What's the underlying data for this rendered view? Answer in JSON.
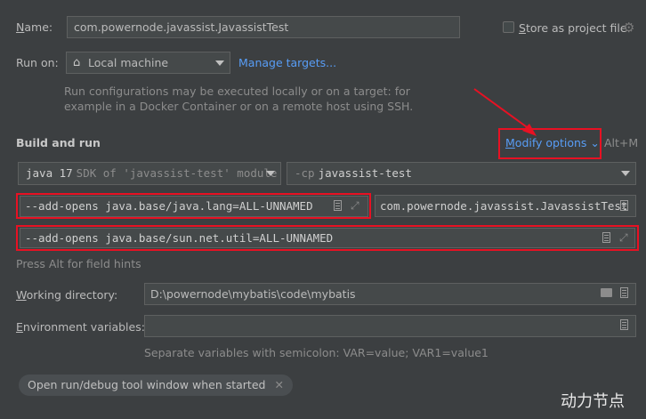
{
  "name": {
    "label": "Name:",
    "value": "com.powernode.javassist.JavassistTest"
  },
  "store_project_file": {
    "label": "Store as project file",
    "checked": false
  },
  "run_on": {
    "label": "Run on:",
    "selected": "Local machine",
    "manage_link": "Manage targets...",
    "hint_line1": "Run configurations may be executed locally or on a target: for",
    "hint_line2": "example in a Docker Container or on a remote host using SSH."
  },
  "build_and_run": {
    "title": "Build and run",
    "modify_options": "Modify options",
    "shortcut": "Alt+M",
    "jdk": {
      "version": "java 17",
      "desc": "SDK of 'javassist-test' module"
    },
    "classpath": {
      "flag": "-cp",
      "value": "javassist-test"
    },
    "vm_options_1": "--add-opens java.base/java.lang=ALL-UNNAMED",
    "main_class": "com.powernode.javassist.JavassistTest",
    "vm_options_2": "--add-opens java.base/sun.net.util=ALL-UNNAMED",
    "field_hint": "Press Alt for field hints"
  },
  "working_directory": {
    "label": "Working directory:",
    "value": "D:\\powernode\\mybatis\\code\\mybatis"
  },
  "env_vars": {
    "label": "Environment variables:",
    "value": "",
    "hint": "Separate variables with semicolon: VAR=value; VAR1=value1"
  },
  "tag_button": "Open run/debug tool window when started",
  "watermark": "动力节点",
  "colors": {
    "background": "#3c3f41",
    "field": "#45494a",
    "link": "#589df6",
    "highlight": "#e81123"
  }
}
